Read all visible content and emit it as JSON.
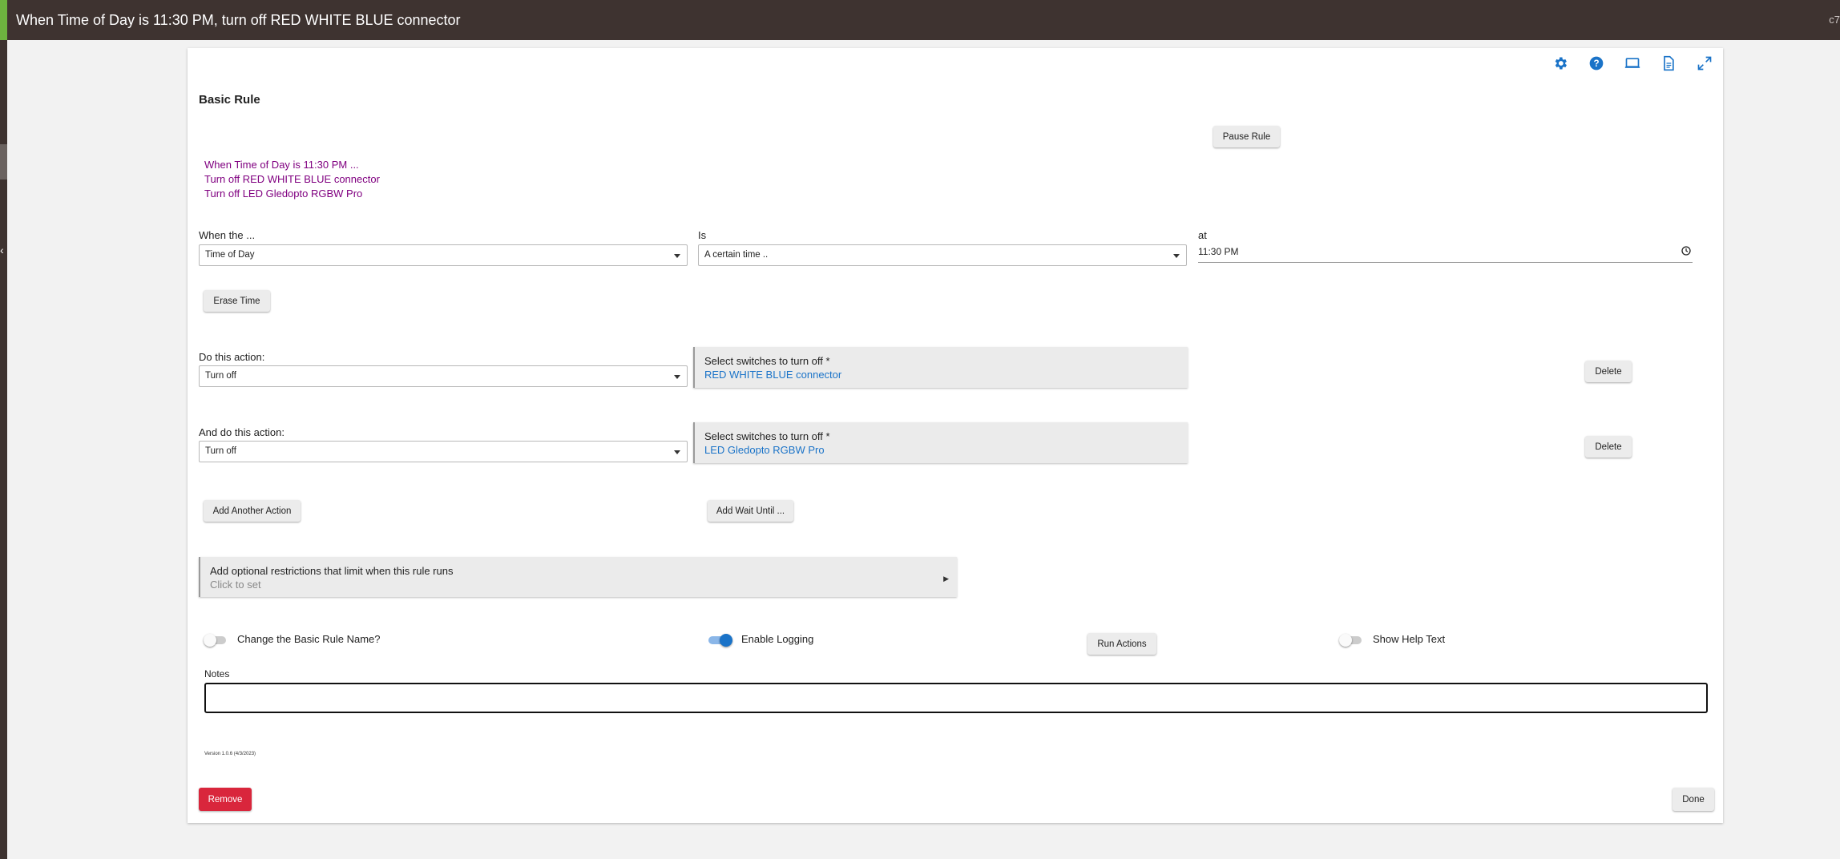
{
  "window": {
    "title": "When Time of Day is 11:30 PM, turn off RED WHITE BLUE connector",
    "right_corner_text": "c7"
  },
  "header": {
    "title": "Basic Rule",
    "pause_label": "Pause Rule"
  },
  "toolbar_icons": [
    "gear-icon",
    "help-icon",
    "laptop-icon",
    "document-icon",
    "expand-icon"
  ],
  "summary": [
    "When Time of Day is 11:30 PM ...",
    "Turn off RED WHITE BLUE connector",
    "Turn off LED Gledopto RGBW Pro"
  ],
  "trigger": {
    "when_label": "When the ...",
    "when_value": "Time of Day",
    "is_label": "Is",
    "is_value": "A certain time ..",
    "at_label": "at",
    "at_value": "11:30 PM",
    "erase_label": "Erase Time"
  },
  "actions": [
    {
      "label": "Do this action:",
      "value": "Turn off",
      "switches_label": "Select switches to turn off *",
      "switches_value": "RED WHITE BLUE connector",
      "delete_label": "Delete"
    },
    {
      "label": "And do this action:",
      "value": "Turn off",
      "switches_label": "Select switches to turn off *",
      "switches_value": "LED Gledopto RGBW Pro",
      "delete_label": "Delete"
    }
  ],
  "add_action_label": "Add Another Action",
  "add_wait_label": "Add Wait Until ...",
  "restrictions": {
    "title": "Add optional restrictions that limit when this rule runs",
    "sub": "Click to set"
  },
  "options": {
    "rename": {
      "label": "Change the Basic Rule Name?",
      "on": false
    },
    "logging": {
      "label": "Enable Logging",
      "on": true
    },
    "run_label": "Run Actions",
    "help": {
      "label": "Show Help Text",
      "on": false
    }
  },
  "notes": {
    "label": "Notes",
    "value": ""
  },
  "version": "Version 1.0.6 (4/3/2023)",
  "remove_label": "Remove",
  "done_label": "Done",
  "colors": {
    "accent": "#1a73c8",
    "remove": "#d9263c",
    "summary": "#800080",
    "titlebar": "#3e3330"
  }
}
